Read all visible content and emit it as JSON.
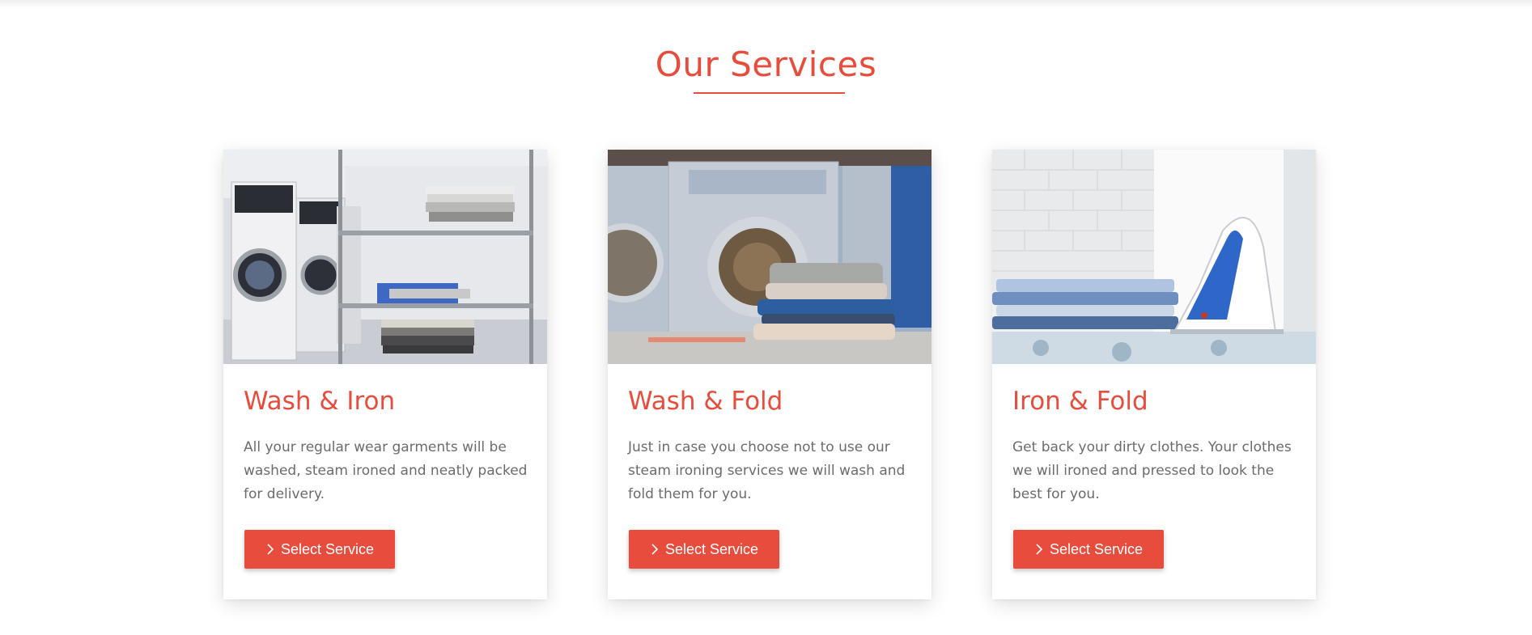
{
  "section": {
    "title": "Our Services",
    "accent_color": "#e74c3c"
  },
  "services": [
    {
      "title": "Wash & Iron",
      "description": "All your regular wear garments will be washed, steam ironed and neatly packed for delivery.",
      "button_label": "Select Service",
      "button_icon": "chevron-right-icon",
      "image": "laundromat-machines-folded-clothes-photo"
    },
    {
      "title": "Wash & Fold",
      "description": "Just in case you choose not to use our steam ironing services we will wash and fold them for you.",
      "button_label": "Select Service",
      "button_icon": "chevron-right-icon",
      "image": "washing-machine-clothes-pile-photo"
    },
    {
      "title": "Iron & Fold",
      "description": "Get back your dirty clothes. Your clothes we will ironed and pressed to look the best for you.",
      "button_label": "Select Service",
      "button_icon": "chevron-right-icon",
      "image": "steam-iron-folded-shirts-photo"
    }
  ]
}
